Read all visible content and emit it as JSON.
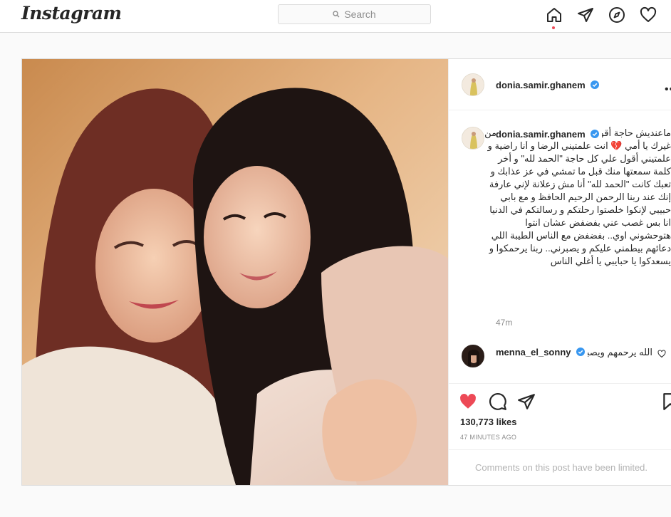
{
  "header": {
    "logo": "Instagram",
    "search_placeholder": "Search",
    "icons": [
      "home-icon",
      "direct-icon",
      "explore-icon",
      "activity-heart-icon"
    ]
  },
  "post": {
    "author": "donia.samir.ghanem",
    "caption_author": "donia.samir.ghanem",
    "caption": "ماعنديش حاجة أقولها غير إني فعلا بقيت يتيمة من غيرك يا أمي 💔 انت علمتيني الرضا و أنا راضية و علمتيني أقول علي كل حاجة \"الحمد لله\" و أخر كلمة سمعتها منك قبل ما تمشي في عز عذابك و تعبك كانت \"الحمد لله\" أنا مش زعلانة لإني عارفة إنك عند ربنا الرحمن الرحيم الحافظ و مع بابي حبيبي لإنكوا خلصتوا رحلتكم و رسالتكم في الدنيا انا بس غصب عني بفضفض عشان انتوا هتوحشوني اوي.. بفضفض مع الناس الطيبة اللي دعائهم بيطمني عليكم و يصبرني.. ربنا يرحمكوا و يسعدكوا يا حبايبي يا أغلي الناس",
    "caption_age": "47m",
    "comment": {
      "user": "menna_el_sonny",
      "text": "الله يرحمهم ويصبركم ❤️"
    },
    "likes": "130,773 likes",
    "posted_ago": "47 MINUTES AGO",
    "comments_limited": "Comments on this post have been limited.",
    "colors": {
      "verified": "#3897f0",
      "liked": "#ed4956"
    }
  }
}
